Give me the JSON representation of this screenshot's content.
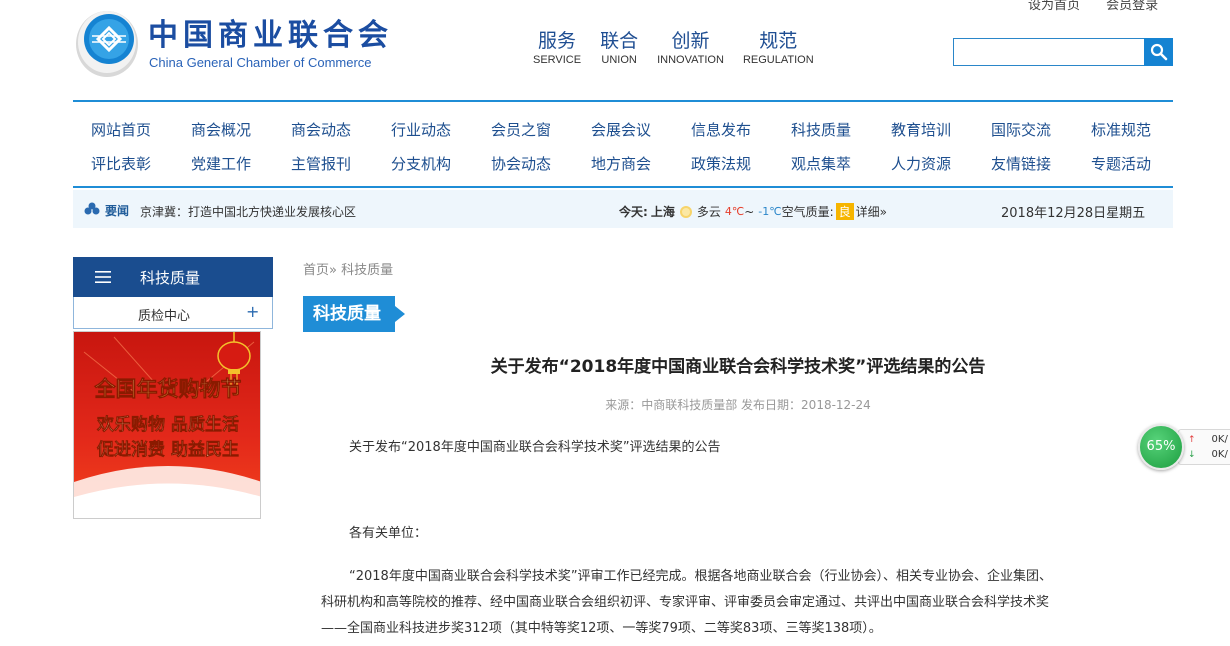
{
  "top_links": {
    "home": "设为首页",
    "login": "会员登录"
  },
  "logo": {
    "cn": "中国商业联合会",
    "en": "China General Chamber of Commerce"
  },
  "main_nav": [
    {
      "cn": "服务",
      "en": "SERVICE"
    },
    {
      "cn": "联合",
      "en": "UNION"
    },
    {
      "cn": "创新",
      "en": "INNOVATION"
    },
    {
      "cn": "规范",
      "en": "REGULATION"
    }
  ],
  "search": {
    "value": "",
    "placeholder": ""
  },
  "category_nav": {
    "row1": [
      "网站首页",
      "商会概况",
      "商会动态",
      "行业动态",
      "会员之窗",
      "会展会议",
      "信息发布",
      "科技质量",
      "教育培训",
      "国际交流",
      "标准规范"
    ],
    "row2": [
      "评比表彰",
      "党建工作",
      "主管报刊",
      "分支机构",
      "协会动态",
      "地方商会",
      "政策法规",
      "观点集萃",
      "人力资源",
      "友情链接",
      "专题活动"
    ]
  },
  "news_bar": {
    "tag": "要闻",
    "headline": "京津冀：打造中国北方快递业发展核心区",
    "weather": {
      "label": "今天:",
      "city": "上海",
      "condition": "多云",
      "high": "4℃",
      "sep": "~",
      "low": "-1℃",
      "aq_label": "空气质量:",
      "aq_value": "良",
      "detail": "详细»"
    },
    "date": "2018年12月28日星期五"
  },
  "sidebar": {
    "title": "科技质量",
    "item": "质检中心",
    "expand_symbol": "+",
    "banner": {
      "title": "全国年货购物节",
      "line1": "欢乐购物 品质生活",
      "line2": "促进消费 助益民生"
    }
  },
  "breadcrumb": {
    "home": "首页",
    "sep": "»",
    "current": "科技质量"
  },
  "section_label": "科技质量",
  "article": {
    "title": "关于发布“2018年度中国商业联合会科学技术奖”评选结果的公告",
    "source": "来源：中商联科技质量部",
    "date": "发布日期：2018-12-24",
    "subtitle": "关于发布“2018年度中国商业联合会科学技术奖”评选结果的公告",
    "greeting": "各有关单位：",
    "body1": "“2018年度中国商业联合会科学技术奖”评审工作已经完成。根据各地商业联合会（行业协会）、相关专业协会、企业集团、",
    "body2": "科研机构和高等院校的推荐、经中国商业联合会组织初评、专家评审、评审委员会审定通过、共评出中国商业联合会科学技术奖",
    "body3": "——全国商业科技进步奖312项（其中特等奖12项、一等奖79项、二等奖83项、三等奖138项）。"
  },
  "widget": {
    "percent": "65%",
    "up": "0K/",
    "down": "0K/"
  },
  "colors": {
    "brand_blue": "#1a4d8f",
    "accent_blue": "#1f8dd6",
    "weather_high": "#e63f2c",
    "weather_low": "#2a86c9",
    "aq_badge": "#f6b500"
  }
}
